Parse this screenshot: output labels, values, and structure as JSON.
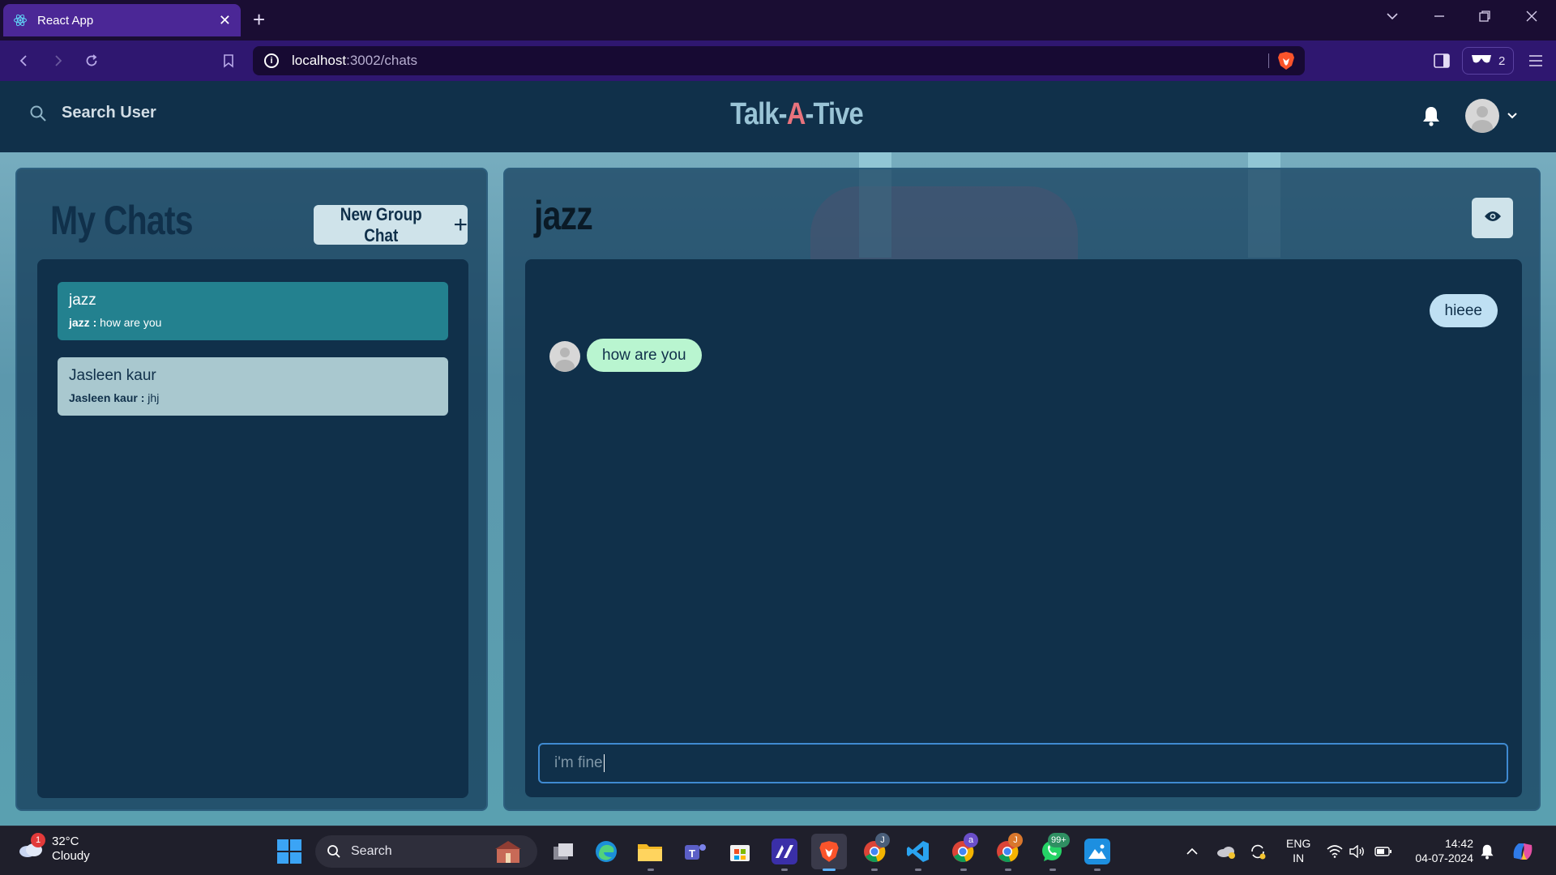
{
  "browser": {
    "tab_title": "React App",
    "url_host": "localhost",
    "url_path": ":3002/chats",
    "ext_count": "2"
  },
  "app": {
    "search_label": "Search User",
    "brand_left": "Talk-",
    "brand_mid": "A",
    "brand_right": "-Tive"
  },
  "my_chats": {
    "title": "My Chats",
    "new_group_label": "New Group Chat",
    "new_group_icon": "+",
    "items": [
      {
        "name": "jazz",
        "sender": "jazz",
        "separator": " : ",
        "last_message": "how are you",
        "active": true
      },
      {
        "name": "Jasleen kaur",
        "sender": "Jasleen kaur",
        "separator": " : ",
        "last_message": "jhj",
        "active": false
      }
    ]
  },
  "chat": {
    "name": "jazz",
    "messages": [
      {
        "text": "hieee",
        "direction": "sent"
      },
      {
        "text": "how are you",
        "direction": "received"
      }
    ],
    "input_value": "i'm fine"
  },
  "taskbar": {
    "weather_temp": "32°C",
    "weather_desc": "Cloudy",
    "weather_badge": "1",
    "search_label": "Search",
    "whatsapp_badge": "99+",
    "chrome_badge_1": "J",
    "chrome_badge_2": "a",
    "chrome_badge_3": "J",
    "lang_top": "ENG",
    "lang_bottom": "IN",
    "time": "14:42",
    "date": "04-07-2024"
  },
  "colors": {
    "header_bg": "#10304a",
    "active_chat": "#23818f",
    "inactive_chat": "#a9c8cf",
    "sent_bubble": "#bfe0f3",
    "received_bubble": "#b9f5d0",
    "brand_accent": "#e8737d",
    "browser_tab": "#4b2796"
  }
}
